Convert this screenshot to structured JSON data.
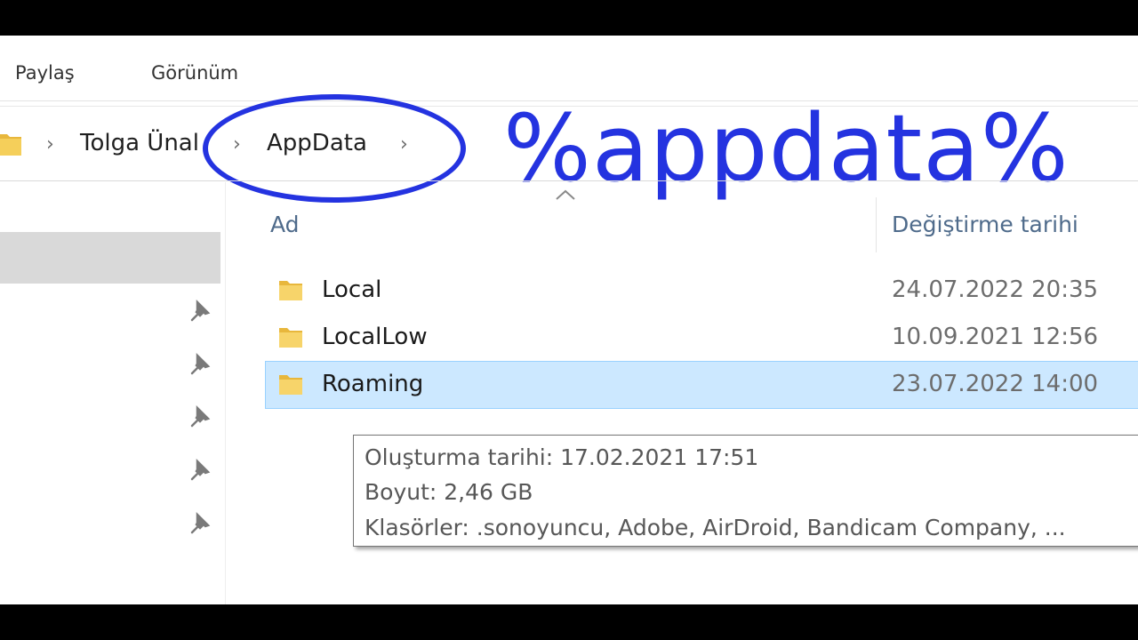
{
  "ribbon": {
    "tabs": [
      {
        "label": "Paylaş"
      },
      {
        "label": "Görünüm"
      }
    ]
  },
  "address_bar": {
    "crumbs": [
      {
        "label": "Tolga Ünal"
      },
      {
        "label": "AppData"
      }
    ]
  },
  "annotation": {
    "text": "%appdata%",
    "color": "#2433e0"
  },
  "file_list": {
    "columns": [
      {
        "label": "Ad"
      },
      {
        "label": "Değiştirme tarihi"
      }
    ],
    "rows": [
      {
        "name": "Local",
        "modified": "24.07.2022 20:35",
        "selected": false
      },
      {
        "name": "LocalLow",
        "modified": "10.09.2021 12:56",
        "selected": false
      },
      {
        "name": "Roaming",
        "modified": "23.07.2022 14:00",
        "selected": true
      }
    ]
  },
  "tooltip": {
    "created": "Oluşturma tarihi: 17.02.2021 17:51",
    "size": "Boyut: 2,46 GB",
    "folders": "Klasörler: .sonoyuncu, Adobe, AirDroid, Bandicam Company, ..."
  },
  "colors": {
    "selection": "#cce8ff",
    "folder": "#f2c94c",
    "column_header": "#4f6b8b"
  },
  "icons": {
    "folder": "folder-icon",
    "pin": "pin-icon",
    "chevron": "chevron-right-icon",
    "sort": "sort-up-icon"
  }
}
